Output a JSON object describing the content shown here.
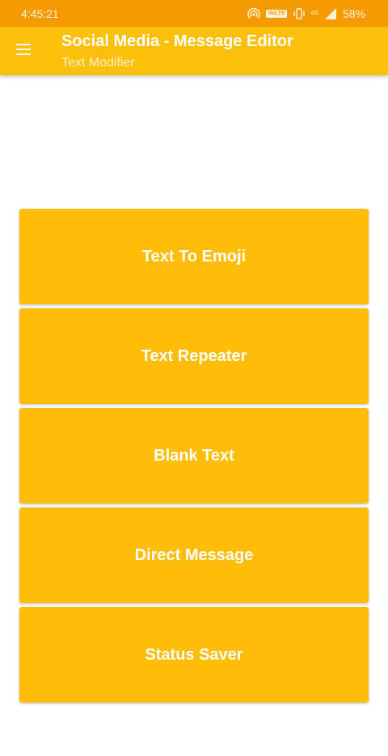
{
  "status_bar": {
    "time": "4:45:21",
    "volte": "VoLTE",
    "network_label": "4G",
    "battery": "58%",
    "icons": [
      "hotspot-icon",
      "volte-icon",
      "vibrate-icon",
      "signal-icon"
    ]
  },
  "app_bar": {
    "title": "Social Media - Message Editor",
    "subtitle": "Text Modifier",
    "menu_icon": "hamburger-menu-icon"
  },
  "menu": [
    {
      "label": "Text To Emoji"
    },
    {
      "label": "Text Repeater"
    },
    {
      "label": "Blank Text"
    },
    {
      "label": "Direct Message"
    },
    {
      "label": "Status Saver"
    }
  ],
  "colors": {
    "status_bar": "#f59b00",
    "app_bar": "#fcc00b",
    "button": "#fdbd08",
    "button_text": "#ffffff"
  }
}
